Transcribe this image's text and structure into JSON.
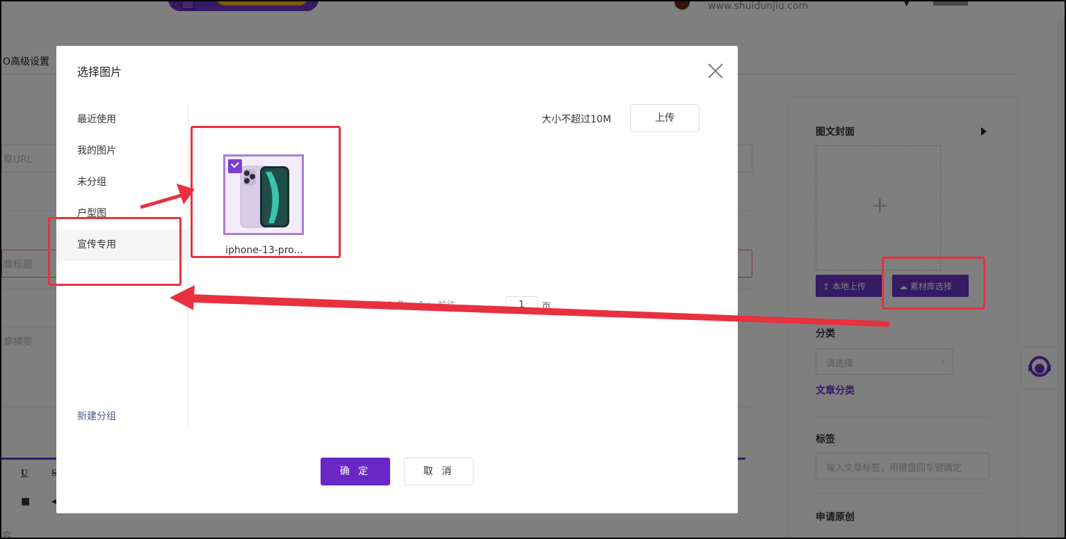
{
  "background": {
    "header_url": "www.shuidunjiu.com",
    "tab_label": "O高级设置",
    "url_placeholder": "章URL",
    "title_placeholder": "章标题",
    "summary_placeholder": "章摘要",
    "editor_underline": "U",
    "editor_strike": "S",
    "editor_tail": "容",
    "sidebar": {
      "cover_label": "图文封面",
      "local_upload_label": "本地上传",
      "library_select_label": "素材库选择",
      "category_label": "分类",
      "category_placeholder": "请选择",
      "category_link": "文章分类",
      "tags_label": "标签",
      "tags_placeholder": "输入文章标签，用键盘回车键确定",
      "original_label": "申请原创"
    }
  },
  "modal": {
    "title": "选择图片",
    "categories": [
      {
        "label": "最近使用"
      },
      {
        "label": "我的图片"
      },
      {
        "label": "未分组"
      },
      {
        "label": "户型图"
      },
      {
        "label": "宣传专用"
      }
    ],
    "new_group_label": "新建分组",
    "size_hint": "大小不超过10M",
    "upload_label": "上传",
    "image": {
      "name": "iphone-13-pro...",
      "selected": true
    },
    "pager": {
      "prefix": "共 1 条   <   1   >   前往",
      "current": "1",
      "suffix": "页"
    },
    "confirm_label": "确 定",
    "cancel_label": "取 消"
  },
  "colors": {
    "accent": "#6b26c7",
    "annotation": "#e8303f"
  }
}
